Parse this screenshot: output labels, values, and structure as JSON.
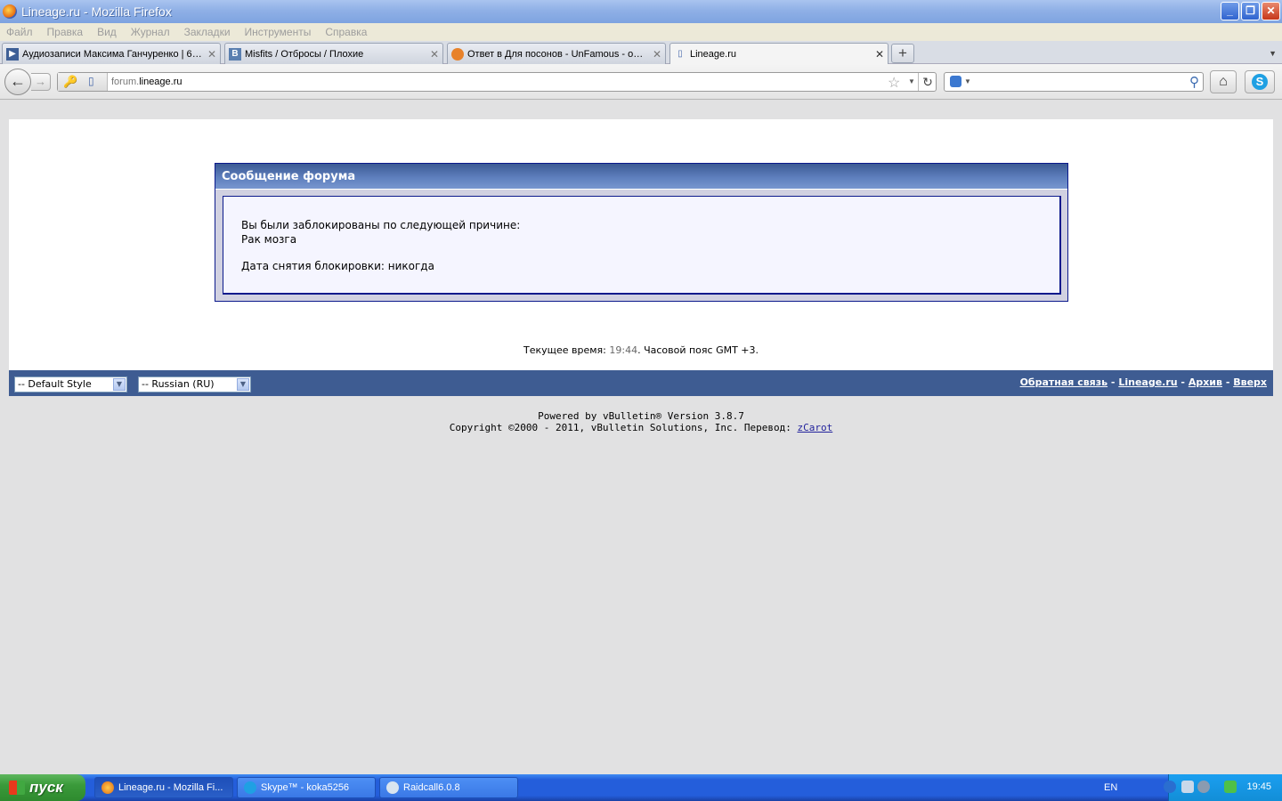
{
  "window": {
    "title": "Lineage.ru - Mozilla Firefox"
  },
  "menu": [
    "Файл",
    "Правка",
    "Вид",
    "Журнал",
    "Закладки",
    "Инструменты",
    "Справка"
  ],
  "tabs": [
    {
      "label": "Аудиозаписи Максима Ганчуренко | 63...",
      "icon": "play-icon"
    },
    {
      "label": "Misfits / Отбросы / Плохие",
      "icon": "vk-icon"
    },
    {
      "label": "Ответ в Для посонов - UnFamous - офи...",
      "icon": "forum-icon"
    },
    {
      "label": "Lineage.ru",
      "icon": "page-icon"
    }
  ],
  "address": {
    "sub": "forum.",
    "domain": "lineage.ru"
  },
  "message": {
    "header": "Сообщение форума",
    "line1": "Вы были заблокированы по следующей причине:",
    "line2": "Рак мозга",
    "line3": "Дата снятия блокировки: никогда"
  },
  "time": {
    "prefix": "Текущее время:",
    "value": "19:44",
    "suffix": ". Часовой пояс GMT +3."
  },
  "footer": {
    "style_select": "-- Default Style",
    "lang_select": "-- Russian (RU)",
    "links": [
      "Обратная связь",
      "Lineage.ru",
      "Архив",
      "Вверх"
    ],
    "separator": " - "
  },
  "copyright": {
    "line1": "Powered by vBulletin® Version 3.8.7",
    "line2": "Copyright ©2000 - 2011, vBulletin Solutions, Inc. Перевод:",
    "link": "zCarot"
  },
  "taskbar": {
    "start": "пуск",
    "tasks": [
      "Lineage.ru - Mozilla Fi...",
      "Skype™ - koka5256",
      "Raidcall6.0.8"
    ],
    "lang": "EN",
    "clock": "19:45"
  }
}
